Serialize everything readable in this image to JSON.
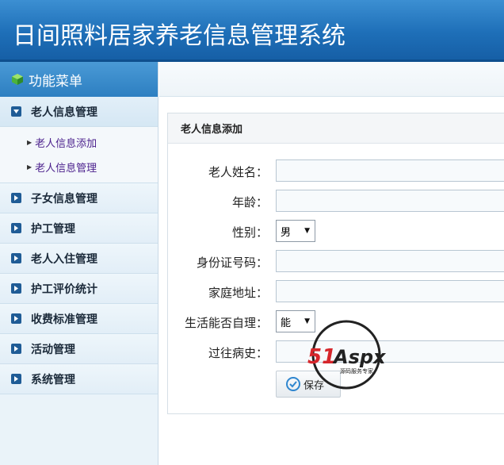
{
  "app": {
    "title": "日间照料居家养老信息管理系统"
  },
  "sidebar": {
    "heading": "功能菜单",
    "items": [
      {
        "label": "老人信息管理",
        "open": true,
        "children": [
          "老人信息添加",
          "老人信息管理"
        ]
      },
      {
        "label": "子女信息管理"
      },
      {
        "label": "护工管理"
      },
      {
        "label": "老人入住管理"
      },
      {
        "label": "护工评价统计"
      },
      {
        "label": "收费标准管理"
      },
      {
        "label": "活动管理"
      },
      {
        "label": "系统管理"
      }
    ]
  },
  "form": {
    "title": "老人信息添加",
    "fields": {
      "name": {
        "label": "老人姓名：",
        "value": ""
      },
      "age": {
        "label": "年龄：",
        "value": ""
      },
      "gender": {
        "label": "性别：",
        "value": "男"
      },
      "id_number": {
        "label": "身份证号码：",
        "value": ""
      },
      "address": {
        "label": "家庭地址：",
        "value": ""
      },
      "self_care": {
        "label": "生活能否自理：",
        "value": "能"
      },
      "history": {
        "label": "过往病史：",
        "value": ""
      }
    },
    "save_label": "保存"
  },
  "watermark": {
    "brand": "51Aspx",
    "tagline": "源码服务专家"
  },
  "colors": {
    "header": "#1e6fb8",
    "menu_icon": "#1f5c96",
    "submenu_text": "#4a1f8c"
  }
}
